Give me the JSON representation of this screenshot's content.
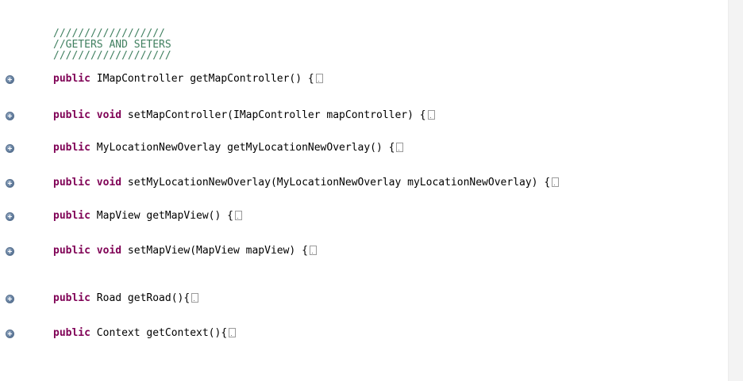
{
  "comments": {
    "line1": "//////////////////",
    "line2": "//GETERS AND SETERS",
    "line3": "///////////////////"
  },
  "methods": [
    {
      "keyword": "public",
      "keyword2": "",
      "rest": " IMapController getMapController() {"
    },
    {
      "keyword": "public",
      "keyword2": "void",
      "rest": " setMapController(IMapController mapController) {"
    },
    {
      "keyword": "public",
      "keyword2": "",
      "rest": " MyLocationNewOverlay getMyLocationNewOverlay() {"
    },
    {
      "keyword": "public",
      "keyword2": "void",
      "rest": " setMyLocationNewOverlay(MyLocationNewOverlay myLocationNewOverlay) {"
    },
    {
      "keyword": "public",
      "keyword2": "",
      "rest": " MapView getMapView() {"
    },
    {
      "keyword": "public",
      "keyword2": "void",
      "rest": " setMapView(MapView mapView) {"
    },
    {
      "keyword": "public",
      "keyword2": "",
      "rest": " Road getRoad(){"
    },
    {
      "keyword": "public",
      "keyword2": "",
      "rest": " Context getContext(){"
    }
  ],
  "icons": {
    "fold": "expand-fold-icon",
    "collapsed": "collapsed-code-icon"
  }
}
